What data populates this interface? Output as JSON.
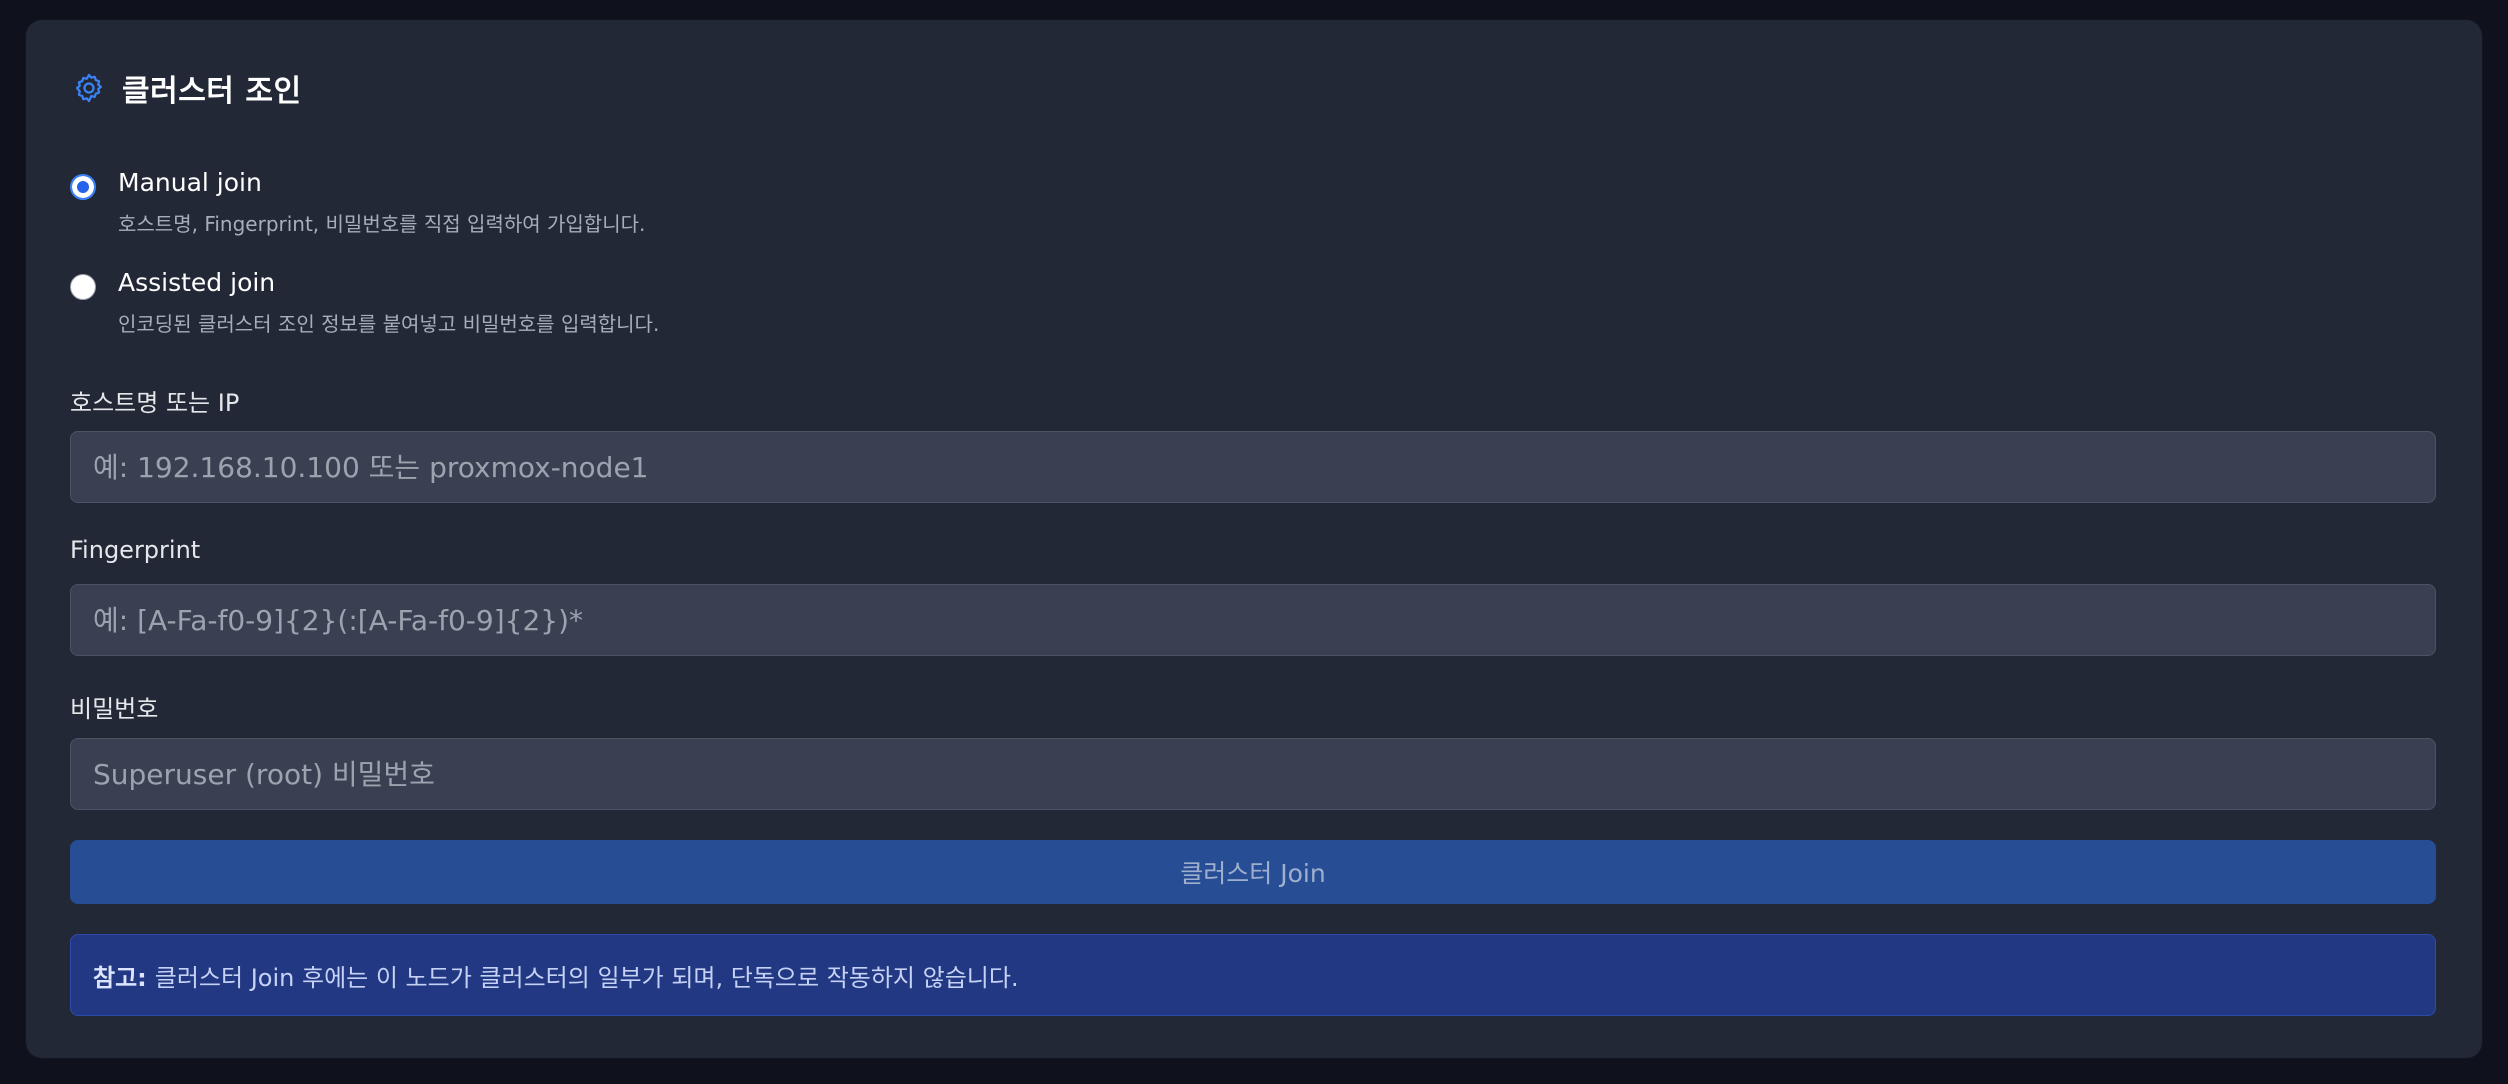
{
  "header": {
    "title": "클러스터 조인",
    "icon": "gear-icon",
    "icon_color": "#3b82f6"
  },
  "join_mode": {
    "options": [
      {
        "label": "Manual join",
        "description": "호스트명, Fingerprint, 비밀번호를 직접 입력하여 가입합니다.",
        "checked": true
      },
      {
        "label": "Assisted join",
        "description": "인코딩된 클러스터 조인 정보를 붙여넣고 비밀번호를 입력합니다.",
        "checked": false
      }
    ]
  },
  "fields": {
    "host": {
      "label": "호스트명 또는 IP",
      "value": "",
      "placeholder": "예: 192.168.10.100 또는 proxmox-node1"
    },
    "fingerprint": {
      "label": "Fingerprint",
      "value": "",
      "placeholder": "예: [A-Fa-f0-9]{2}(:[A-Fa-f0-9]{2})*"
    },
    "password": {
      "label": "비밀번호",
      "value": "",
      "placeholder": "Superuser (root) 비밀번호"
    }
  },
  "join_button": {
    "label": "클러스터 Join"
  },
  "note": {
    "prefix": "참고:",
    "text": "클러스터 Join 후에는 이 노드가 클러스터의 일부가 되며, 단독으로 작동하지 않습니다."
  },
  "colors": {
    "page_background": "#0f121d",
    "card_background": "#222835",
    "accent": "#3b82f6",
    "button": "#274d94",
    "note_background": "#233882"
  }
}
